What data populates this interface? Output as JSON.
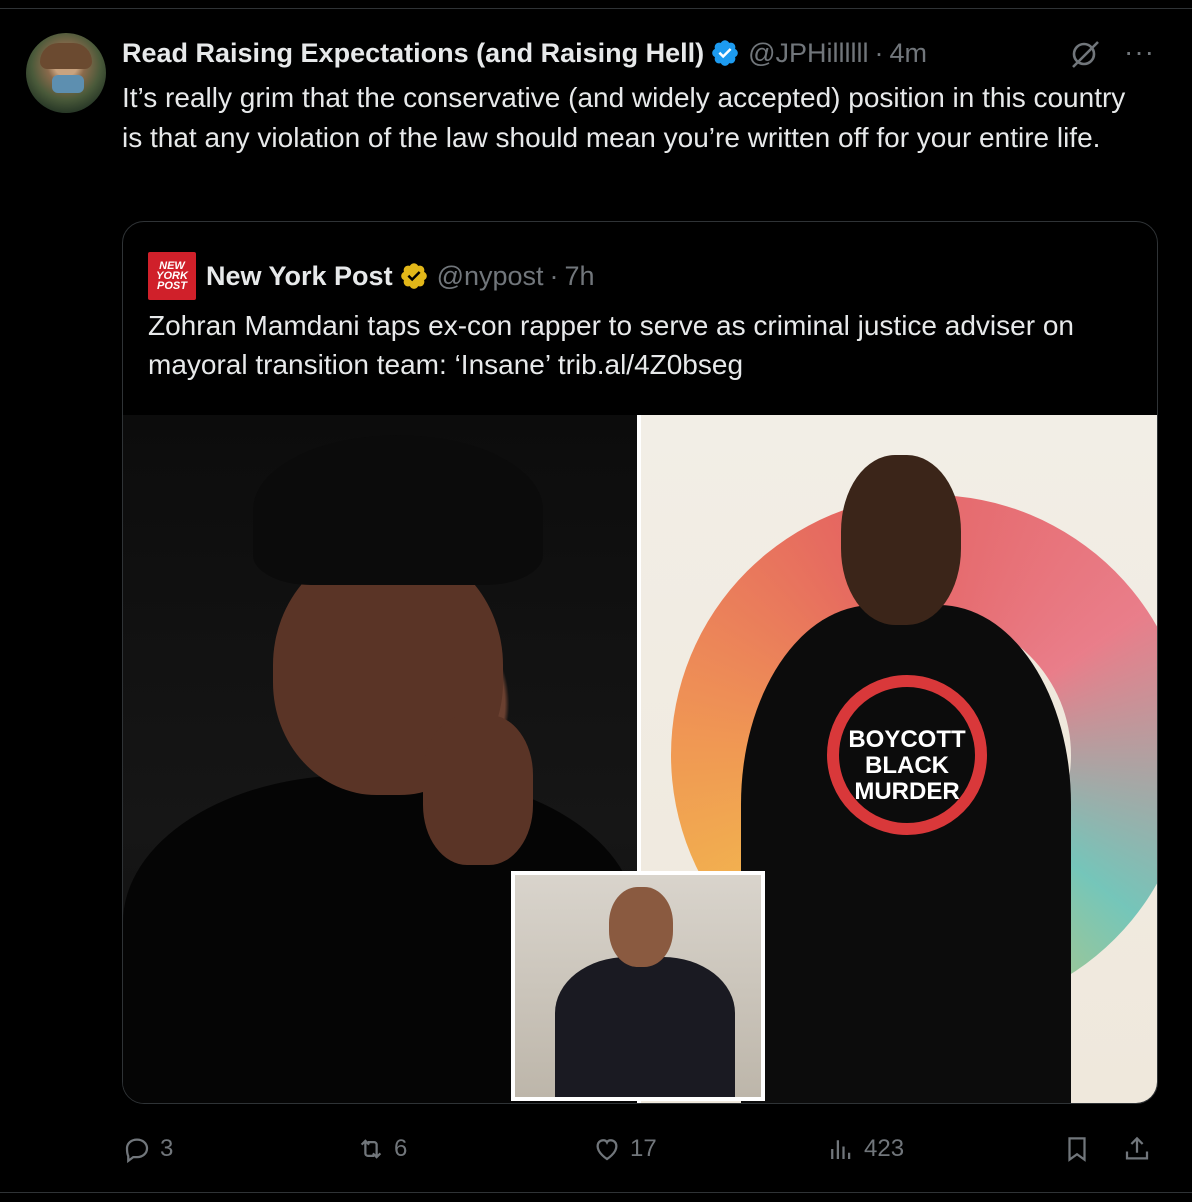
{
  "post": {
    "author_name": "Read Raising Expectations (and Raising Hell)",
    "handle": "@JPHillllll",
    "separator": "·",
    "time": "4m",
    "more_label": "···",
    "text": "It’s really grim that the conservative (and widely accepted) position in this country is that any violation of the law should mean you’re written off for your entire life."
  },
  "quote": {
    "logo_lines": [
      "NEW",
      "YORK",
      "POST"
    ],
    "author_name": "New York Post",
    "handle": "@nypost",
    "separator": "·",
    "time": "7h",
    "text": "Zohran Mamdani taps ex-con rapper to serve as criminal justice adviser on mayoral transition team: ‘Insane’ trib.al/4Z0bseg",
    "shirt_text": "BOYCOTT BLACK MURDER"
  },
  "actions": {
    "replies": "3",
    "reposts": "6",
    "likes": "17",
    "views": "423"
  },
  "colors": {
    "background": "#000000",
    "text": "#e7e9ea",
    "muted": "#71767b",
    "verified_blue": "#1d9bf0",
    "verified_gold": "#e2b719",
    "nypost_red": "#d0202a",
    "border": "#2f3336"
  },
  "icons": [
    "verified-badge-icon",
    "grok-icon",
    "more-icon",
    "gold-verified-icon",
    "reply-icon",
    "repost-icon",
    "like-icon",
    "views-icon",
    "bookmark-icon",
    "share-icon"
  ]
}
